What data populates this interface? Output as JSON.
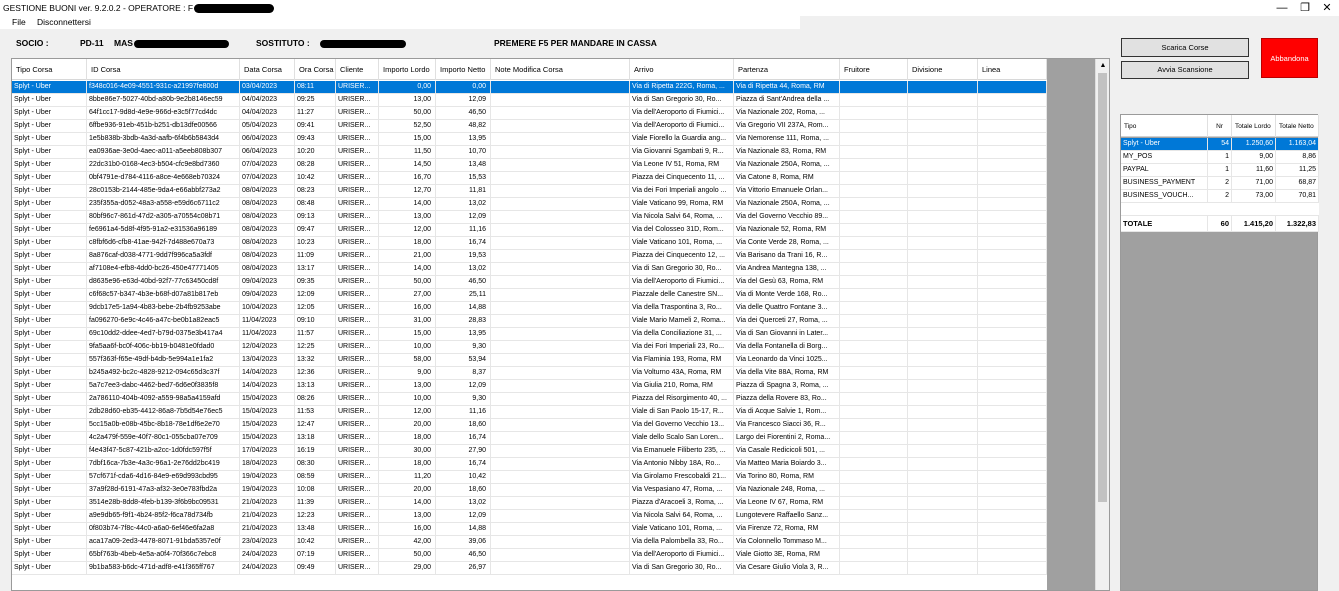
{
  "window": {
    "title": "GESTIONE BUONI ver. 9.2.0.2 - OPERATORE : F",
    "minimize": "—",
    "maximize": "❐",
    "close": "✕"
  },
  "menu": [
    "File",
    "Disconnettersi"
  ],
  "info": {
    "socio_label": "SOCIO :",
    "socio_code": "PD-11",
    "socio_name_prefix": "MAS",
    "sostituto_label": "SOSTITUTO :",
    "notice": "PREMERE F5 PER MANDARE IN CASSA"
  },
  "buttons": {
    "scarica": "Scarica Corse",
    "avvia": "Avvia Scansione",
    "abbandona": "Abbandona"
  },
  "grid": {
    "columns": [
      "Tipo Corsa",
      "ID Corsa",
      "Data Corsa",
      "Ora Corsa",
      "Cliente",
      "Importo Lordo",
      "Importo Netto",
      "Note Modifica Corsa",
      "Arrivo",
      "Partenza",
      "Fruitore",
      "Divisione",
      "Linea"
    ],
    "scroll_up": "▲",
    "rows": [
      [
        "Splyt - Uber",
        "f348c016-4e09-4551-931c-a21997fe800d",
        "03/04/2023",
        "08:11",
        "URISER...",
        "0,00",
        "0,00",
        "",
        "Via di Ripetta 222G, Roma, ...",
        "Via di Ripetta 44, Roma, RM",
        "",
        "",
        ""
      ],
      [
        "Splyt - Uber",
        "8bbe86e7-5027-40bd-a80b-9e2b8146ec59",
        "04/04/2023",
        "09:25",
        "URISER...",
        "13,00",
        "12,09",
        "",
        "Via di San Gregorio 30, Ro...",
        "Piazza di Sant'Andrea della ...",
        "",
        "",
        ""
      ],
      [
        "Splyt - Uber",
        "64f1cc17-9d8d-4e9e-966d-e3c5f77cd4dc",
        "04/04/2023",
        "11:27",
        "URISER...",
        "50,00",
        "46,50",
        "",
        "Via dell'Aeroporto di Fiumici...",
        "Via Nazionale 202, Roma, ...",
        "",
        "",
        ""
      ],
      [
        "Splyt - Uber",
        "6ffbe936-91eb-451b-b251-db13dfe00566",
        "05/04/2023",
        "09:41",
        "URISER...",
        "52,50",
        "48,82",
        "",
        "Via dell'Aeroporto di Fiumici...",
        "Via Gregorio VII 237A, Rom...",
        "",
        "",
        ""
      ],
      [
        "Splyt - Uber",
        "1e5b838b-3bdb-4a3d-aafb-6f4b6b5843d4",
        "06/04/2023",
        "09:43",
        "URISER...",
        "15,00",
        "13,95",
        "",
        "Viale Fiorello la Guardia ang...",
        "Via Nemorense 111, Roma, ...",
        "",
        "",
        ""
      ],
      [
        "Splyt - Uber",
        "ea0936ae-3e0d-4aec-a011-a5eeb808b307",
        "06/04/2023",
        "10:20",
        "URISER...",
        "11,50",
        "10,70",
        "",
        "Via Giovanni Sgambati 9, R...",
        "Via Nazionale 83, Roma, RM",
        "",
        "",
        ""
      ],
      [
        "Splyt - Uber",
        "22dc31b0-0168-4ec3-b504-cfc9e8bd7360",
        "07/04/2023",
        "08:28",
        "URISER...",
        "14,50",
        "13,48",
        "",
        "Via Leone IV 51, Roma, RM",
        "Via Nazionale 250A, Roma, ...",
        "",
        "",
        ""
      ],
      [
        "Splyt - Uber",
        "0bf4791e-d784-4116-a8ce-4e668eb70324",
        "07/04/2023",
        "10:42",
        "URISER...",
        "16,70",
        "15,53",
        "",
        "Piazza dei Cinquecento 11, ...",
        "Via Catone 8, Roma, RM",
        "",
        "",
        ""
      ],
      [
        "Splyt - Uber",
        "28c0153b-2144-485e-9da4-e66abbf273a2",
        "08/04/2023",
        "08:23",
        "URISER...",
        "12,70",
        "11,81",
        "",
        "Via dei Fori Imperiali angolo ...",
        "Via Vittorio Emanuele Orlan...",
        "",
        "",
        ""
      ],
      [
        "Splyt - Uber",
        "235f355a-d052-48a3-a558-e59d6c6711c2",
        "08/04/2023",
        "08:48",
        "URISER...",
        "14,00",
        "13,02",
        "",
        "Viale Vaticano 99, Roma, RM",
        "Via Nazionale 250A, Roma, ...",
        "",
        "",
        ""
      ],
      [
        "Splyt - Uber",
        "80bf96c7-861d-47d2-a305-a70554c08b71",
        "08/04/2023",
        "09:13",
        "URISER...",
        "13,00",
        "12,09",
        "",
        "Via Nicola Salvi 64, Roma, ...",
        "Via del Governo Vecchio 89...",
        "",
        "",
        ""
      ],
      [
        "Splyt - Uber",
        "fe6961a4-5d8f-4f95-91a2-e31536a96189",
        "08/04/2023",
        "09:47",
        "URISER...",
        "12,00",
        "11,16",
        "",
        "Via del Colosseo 31D, Rom...",
        "Via Nazionale 52, Roma, RM",
        "",
        "",
        ""
      ],
      [
        "Splyt - Uber",
        "c8fbf6d6-cfb8-41ae-942f-7d488e670a73",
        "08/04/2023",
        "10:23",
        "URISER...",
        "18,00",
        "16,74",
        "",
        "Viale Vaticano 101, Roma, ...",
        "Via Conte Verde 28, Roma, ...",
        "",
        "",
        ""
      ],
      [
        "Splyt - Uber",
        "8a876caf-d038-4771-9dd7f996ca5a3fdf",
        "08/04/2023",
        "11:09",
        "URISER...",
        "21,00",
        "19,53",
        "",
        "Piazza dei Cinquecento 12, ...",
        "Via Barisano da Trani 16, R...",
        "",
        "",
        ""
      ],
      [
        "Splyt - Uber",
        "af7108e4-efb8-4dd0-bc26-450e47771405",
        "08/04/2023",
        "13:17",
        "URISER...",
        "14,00",
        "13,02",
        "",
        "Via di San Gregorio 30, Ro...",
        "Via Andrea Mantegna 138, ...",
        "",
        "",
        ""
      ],
      [
        "Splyt - Uber",
        "d8635e96-e63d-40bd-92f7-77c63450cd8f",
        "09/04/2023",
        "09:35",
        "URISER...",
        "50,00",
        "46,50",
        "",
        "Via dell'Aeroporto di Fiumici...",
        "Via del Gesù 63, Roma, RM",
        "",
        "",
        ""
      ],
      [
        "Splyt - Uber",
        "c6f68c57-b347-4b3e-b68f-d07a81b817eb",
        "09/04/2023",
        "12:09",
        "URISER...",
        "27,00",
        "25,11",
        "",
        "Piazzale delle Canestre SN...",
        "Via di Monte Verde 168, Ro...",
        "",
        "",
        ""
      ],
      [
        "Splyt - Uber",
        "9dcb17e5-1a94-4b83-bebe-2b4fb9253abe",
        "10/04/2023",
        "12:05",
        "URISER...",
        "16,00",
        "14,88",
        "",
        "Via della Traspontina 3, Ro...",
        "Via delle Quattro Fontane 3...",
        "",
        "",
        ""
      ],
      [
        "Splyt - Uber",
        "fa096270-6e9c-4c46-a47c-be0b1a82eac5",
        "11/04/2023",
        "09:10",
        "URISER...",
        "31,00",
        "28,83",
        "",
        "Viale Mario Mameli 2, Roma...",
        "Via dei Querceti 27, Roma, ...",
        "",
        "",
        ""
      ],
      [
        "Splyt - Uber",
        "69c10dd2-ddee-4ed7-b79d-0375e3b417a4",
        "11/04/2023",
        "11:57",
        "URISER...",
        "15,00",
        "13,95",
        "",
        "Via della Conciliazione 31, ...",
        "Via di San Giovanni in Later...",
        "",
        "",
        ""
      ],
      [
        "Splyt - Uber",
        "9fa5aa6f-bc0f-406c-bb19-b0481e0fdad0",
        "12/04/2023",
        "12:25",
        "URISER...",
        "10,00",
        "9,30",
        "",
        "Via dei Fori Imperiali 23, Ro...",
        "Via della Fontanella di Borg...",
        "",
        "",
        ""
      ],
      [
        "Splyt - Uber",
        "557f363f-f65e-49df-b4db-5e994a1e1fa2",
        "13/04/2023",
        "13:32",
        "URISER...",
        "58,00",
        "53,94",
        "",
        "Via Flaminia 193, Roma, RM",
        "Via Leonardo da Vinci 1025...",
        "",
        "",
        ""
      ],
      [
        "Splyt - Uber",
        "b245a492-bc2c-4828-9212-094c65d3c37f",
        "14/04/2023",
        "12:36",
        "URISER...",
        "9,00",
        "8,37",
        "",
        "Via Volturno 43A, Roma, RM",
        "Via della Vite 88A, Roma, RM",
        "",
        "",
        ""
      ],
      [
        "Splyt - Uber",
        "5a7c7ee3-dabc-4462-bed7-6d6e0f3835f8",
        "14/04/2023",
        "13:13",
        "URISER...",
        "13,00",
        "12,09",
        "",
        "Via Giulia 210, Roma, RM",
        "Piazza di Spagna 3, Roma, ...",
        "",
        "",
        ""
      ],
      [
        "Splyt - Uber",
        "2a786110-404b-4092-a559-98a5a4159afd",
        "15/04/2023",
        "08:26",
        "URISER...",
        "10,00",
        "9,30",
        "",
        "Piazza del Risorgimento 40, ...",
        "Piazza della Rovere 83, Ro...",
        "",
        "",
        ""
      ],
      [
        "Splyt - Uber",
        "2db28d60-eb35-4412-86a8-7b5d54e76ec5",
        "15/04/2023",
        "11:53",
        "URISER...",
        "12,00",
        "11,16",
        "",
        "Viale di San Paolo 15-17, R...",
        "Via di Acque Salvie 1, Rom...",
        "",
        "",
        ""
      ],
      [
        "Splyt - Uber",
        "5cc15a0b-e08b-45bc-8b18-78e1df6e2e70",
        "15/04/2023",
        "12:47",
        "URISER...",
        "20,00",
        "18,60",
        "",
        "Via del Governo Vecchio 13...",
        "Via Francesco Siacci 36, R...",
        "",
        "",
        ""
      ],
      [
        "Splyt - Uber",
        "4c2a479f-559e-40f7-80c1-055cba07e709",
        "15/04/2023",
        "13:18",
        "URISER...",
        "18,00",
        "16,74",
        "",
        "Viale dello Scalo San Loren...",
        "Largo dei Fiorentini 2, Roma...",
        "",
        "",
        ""
      ],
      [
        "Splyt - Uber",
        "f4e43f47-5c87-421b-a2cc-1d0fdc597f5f",
        "17/04/2023",
        "16:19",
        "URISER...",
        "30,00",
        "27,90",
        "",
        "Via Emanuele Filiberto 235, ...",
        "Via Casale Redicicoli 501, ...",
        "",
        "",
        ""
      ],
      [
        "Splyt - Uber",
        "7dbf16ca-7b3e-4a3c-96a1-2e76dd2bc419",
        "18/04/2023",
        "08:30",
        "URISER...",
        "18,00",
        "16,74",
        "",
        "Via Antonio Nibby 18A, Ro...",
        "Via Matteo Maria Boiardo 3...",
        "",
        "",
        ""
      ],
      [
        "Splyt - Uber",
        "57cf671f-cda6-4d16-84e9-e69d993cbd95",
        "19/04/2023",
        "08:59",
        "URISER...",
        "11,20",
        "10,42",
        "",
        "Via Girolamo Frescobaldi 21...",
        "Via Torino 80, Roma, RM",
        "",
        "",
        ""
      ],
      [
        "Splyt - Uber",
        "37a9f28d-6191-47a3-af32-3e0e783fbd2a",
        "19/04/2023",
        "10:08",
        "URISER...",
        "20,00",
        "18,60",
        "",
        "Via Vespasiano 47, Roma, ...",
        "Via Nazionale 248, Roma, ...",
        "",
        "",
        ""
      ],
      [
        "Splyt - Uber",
        "3514e28b-8dd8-4feb-b139-3f6b9bc09531",
        "21/04/2023",
        "11:39",
        "URISER...",
        "14,00",
        "13,02",
        "",
        "Piazza d'Aracoeli 3, Roma, ...",
        "Via Leone IV 67, Roma, RM",
        "",
        "",
        ""
      ],
      [
        "Splyt - Uber",
        "a9e9db65-f9f1-4b24-85f2-f6ca78d734fb",
        "21/04/2023",
        "12:23",
        "URISER...",
        "13,00",
        "12,09",
        "",
        "Via Nicola Salvi 64, Roma, ...",
        "Lungotevere Raffaello Sanz...",
        "",
        "",
        ""
      ],
      [
        "Splyt - Uber",
        "0f803b74-7f8c-44c0-a6a0-6ef46e6fa2a8",
        "21/04/2023",
        "13:48",
        "URISER...",
        "16,00",
        "14,88",
        "",
        "Viale Vaticano 101, Roma, ...",
        "Via Firenze 72, Roma, RM",
        "",
        "",
        ""
      ],
      [
        "Splyt - Uber",
        "aca17a09-2ed3-4478-8071-91bda5357e0f",
        "23/04/2023",
        "10:42",
        "URISER...",
        "42,00",
        "39,06",
        "",
        "Via della Palombella 33, Ro...",
        "Via Colonnello Tommaso M...",
        "",
        "",
        ""
      ],
      [
        "Splyt - Uber",
        "65bf763b-4beb-4e5a-a0f4-70f366c7ebc8",
        "24/04/2023",
        "07:19",
        "URISER...",
        "50,00",
        "46,50",
        "",
        "Via dell'Aeroporto di Fiumici...",
        "Viale Giotto 3E, Roma, RM",
        "",
        "",
        ""
      ],
      [
        "Splyt - Uber",
        "9b1ba583-b6dc-471d-adf8-e41f365ff767",
        "24/04/2023",
        "09:49",
        "URISER...",
        "29,00",
        "26,97",
        "",
        "Via di San Gregorio 30, Ro...",
        "Via Cesare Giulio Viola 3, R...",
        "",
        "",
        ""
      ]
    ]
  },
  "summary": {
    "columns": [
      "Tipo",
      "Nr",
      "Totale Lordo",
      "Totale Netto"
    ],
    "rows": [
      [
        "Splyt - Uber",
        "54",
        "1.250,60",
        "1.163,04"
      ],
      [
        "MY_POS",
        "1",
        "9,00",
        "8,86"
      ],
      [
        "PAYPAL",
        "1",
        "11,60",
        "11,25"
      ],
      [
        "BUSINESS_PAYMENT",
        "2",
        "71,00",
        "68,87"
      ],
      [
        "BUSINESS_VOUCH...",
        "2",
        "73,00",
        "70,81"
      ]
    ],
    "total": [
      "TOTALE",
      "60",
      "1.415,20",
      "1.322,83"
    ]
  },
  "colors": {
    "selection": "#0078d7",
    "abbandona": "#ff0000",
    "empty_area": "#a0a0a0"
  }
}
